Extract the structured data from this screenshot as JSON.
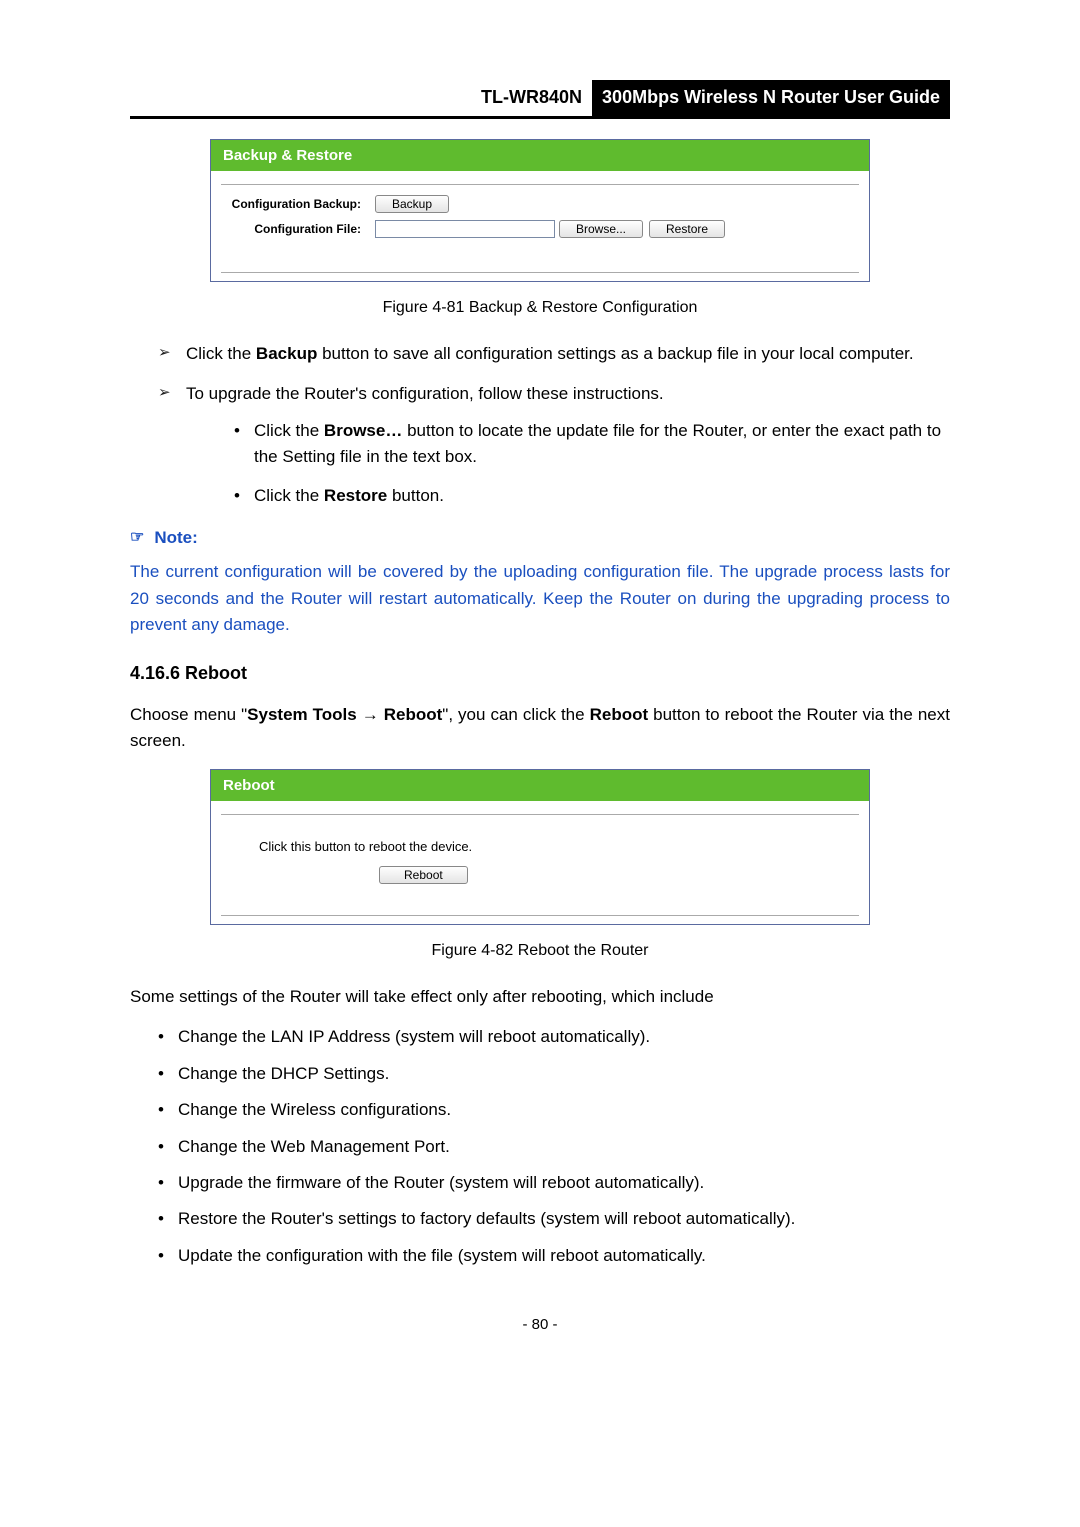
{
  "header": {
    "model": "TL-WR840N",
    "guide": "300Mbps Wireless N Router User Guide"
  },
  "figure1": {
    "panel_title": "Backup & Restore",
    "row1_label": "Configuration Backup:",
    "backup_btn": "Backup",
    "row2_label": "Configuration File:",
    "file_value": "",
    "browse_btn": "Browse...",
    "restore_btn": "Restore",
    "caption": "Figure 4-81    Backup & Restore Configuration"
  },
  "arrow_items": {
    "a1_pre": "Click the ",
    "a1_bold": "Backup",
    "a1_post": " button to save all configuration settings as a backup file in your local computer.",
    "a2": "To upgrade the Router's configuration, follow these instructions."
  },
  "sub_dots": {
    "d1_pre": "Click the ",
    "d1_bold": "Browse…",
    "d1_post": " button to locate the update file for the Router, or enter the exact path to the Setting file in the text box.",
    "d2_pre": "Click the ",
    "d2_bold": "Restore",
    "d2_post": " button."
  },
  "note": {
    "label": "Note:",
    "text": "The current configuration will be covered by the uploading configuration file. The upgrade process lasts for 20 seconds and the Router will restart automatically. Keep the Router on during the upgrading process to prevent any damage."
  },
  "section": {
    "title": "4.16.6 Reboot",
    "p_pre": "Choose menu \"",
    "p_bold1": "System Tools",
    "p_mid1": "  →  ",
    "p_bold2": "Reboot",
    "p_mid2": "\", you can click the ",
    "p_bold3": "Reboot",
    "p_post": " button to reboot the Router via the next screen."
  },
  "figure2": {
    "panel_title": "Reboot",
    "instruction": "Click this button to reboot the device.",
    "reboot_btn": "Reboot",
    "caption": "Figure 4-82 Reboot the Router"
  },
  "after_fig2": "Some settings of the Router will take effect only after rebooting, which include",
  "reboot_list": {
    "i1": "Change the LAN IP Address (system will reboot automatically).",
    "i2": "Change the DHCP Settings.",
    "i3": "Change the Wireless configurations.",
    "i4": "Change the Web Management Port.",
    "i5": "Upgrade the firmware of the Router (system will reboot automatically).",
    "i6": "Restore the Router's settings to factory defaults (system will reboot automatically).",
    "i7": "Update the configuration with the file (system will reboot automatically."
  },
  "page_number": "- 80 -"
}
